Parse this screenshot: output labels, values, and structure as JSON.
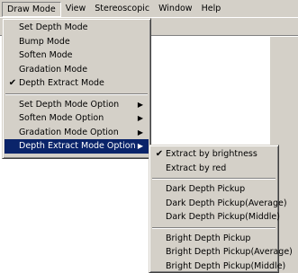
{
  "menubar": {
    "items": [
      {
        "label": "Draw Mode"
      },
      {
        "label": "View"
      },
      {
        "label": "Stereoscopic"
      },
      {
        "label": "Window"
      },
      {
        "label": "Help"
      }
    ]
  },
  "draw_mode_menu": {
    "items": [
      {
        "label": "Set Depth Mode"
      },
      {
        "label": "Bump Mode"
      },
      {
        "label": "Soften Mode"
      },
      {
        "label": "Gradation Mode"
      },
      {
        "label": "Depth Extract Mode",
        "checked": true
      },
      {
        "label": "Set Depth Mode Option"
      },
      {
        "label": "Soften Mode Option"
      },
      {
        "label": "Gradation Mode Option"
      },
      {
        "label": "Depth Extract Mode Option"
      }
    ],
    "check_glyph": "✔",
    "submenu_arrow": "▶"
  },
  "depth_extract_submenu": {
    "items": [
      {
        "label": "Extract by brightness",
        "checked": true
      },
      {
        "label": "Extract by red"
      },
      {
        "label": "Dark Depth Pickup"
      },
      {
        "label": "Dark Depth Pickup(Average)"
      },
      {
        "label": "Dark Depth Pickup(Middle)"
      },
      {
        "label": "Bright Depth Pickup"
      },
      {
        "label": "Bright Depth Pickup(Average)"
      },
      {
        "label": "Bright Depth Pickup(Middle)"
      }
    ]
  },
  "colors": {
    "menu_bg": "#d4d0c8",
    "highlight_bg": "#0a246a",
    "highlight_text": "#ffffff"
  }
}
